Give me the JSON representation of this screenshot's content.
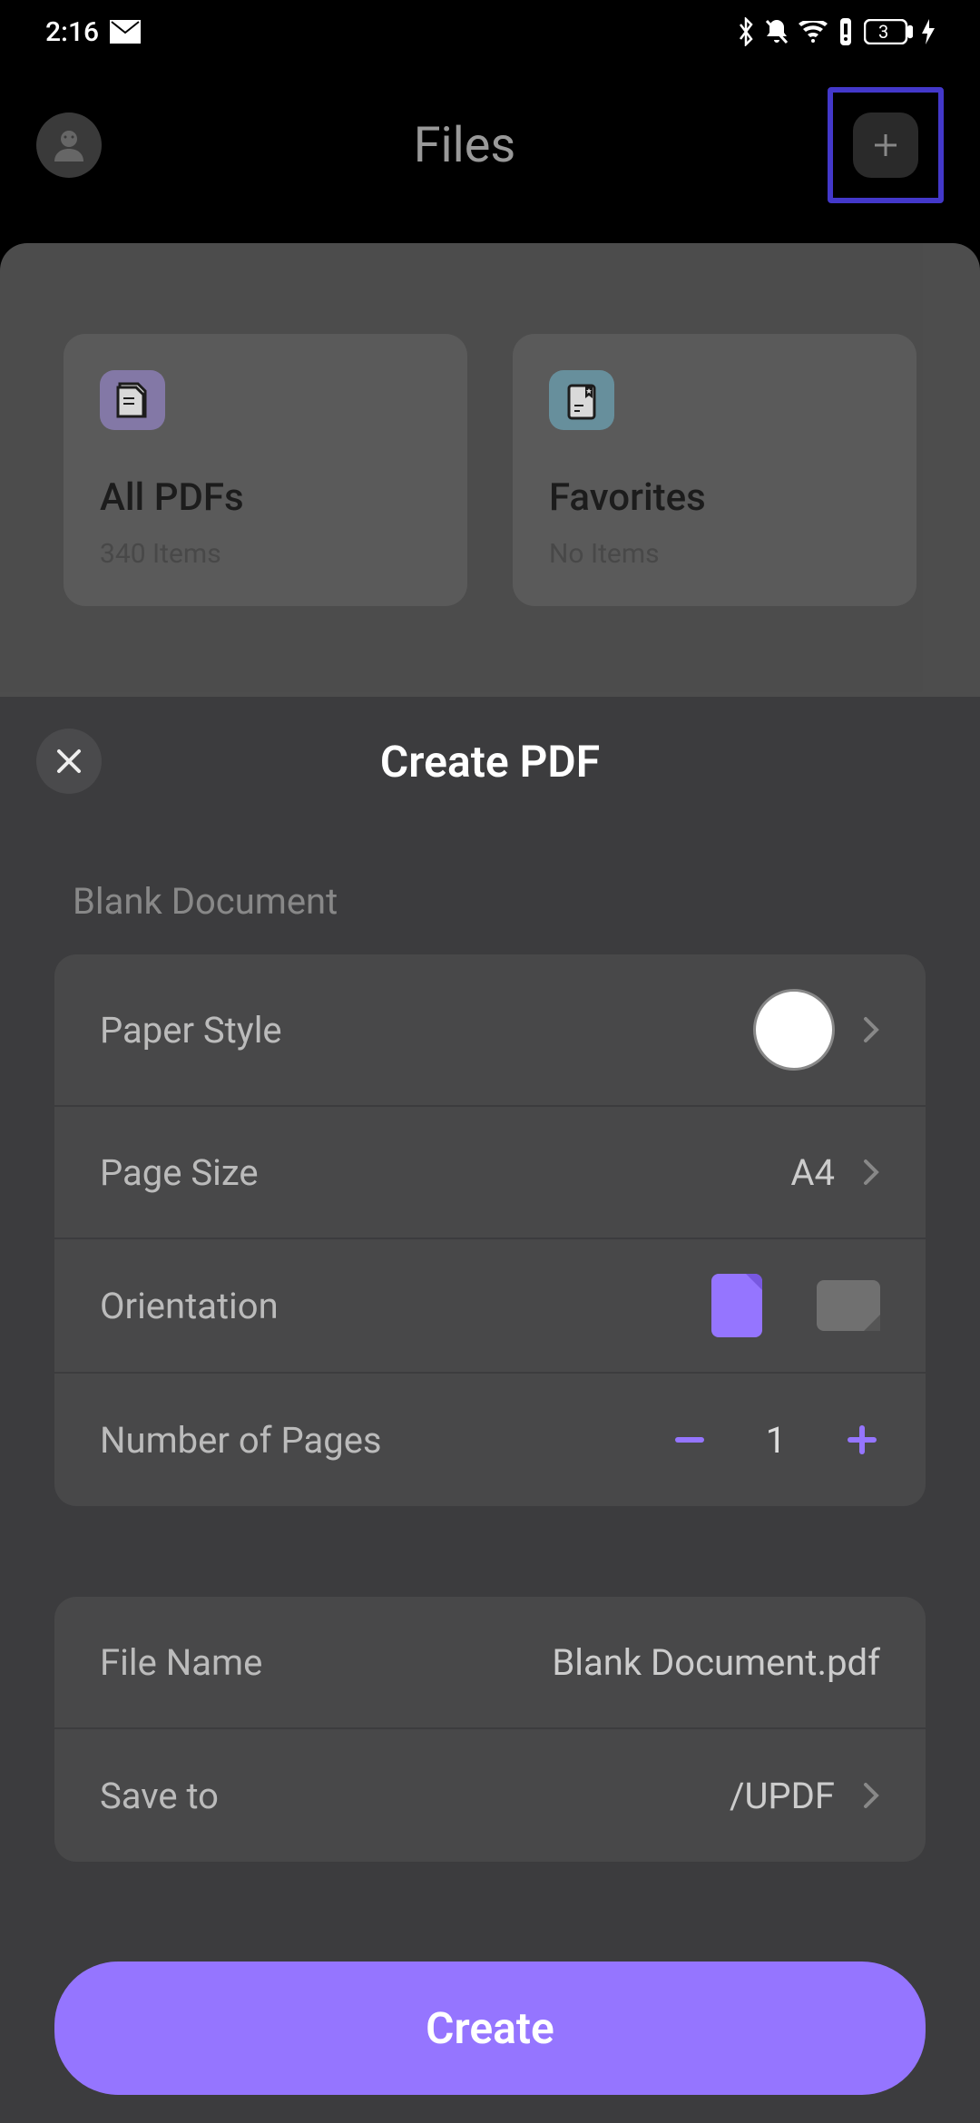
{
  "status": {
    "time": "2:16",
    "battery": "3"
  },
  "header": {
    "title": "Files"
  },
  "bg": {
    "card1": {
      "title": "All PDFs",
      "sub": "340 Items"
    },
    "card2": {
      "title": "Favorites",
      "sub": "No Items"
    }
  },
  "modal": {
    "title": "Create PDF",
    "section_label": "Blank Document",
    "paper_style_label": "Paper Style",
    "page_size_label": "Page Size",
    "page_size_value": "A4",
    "orientation_label": "Orientation",
    "pages_label": "Number of Pages",
    "pages_value": "1",
    "file_name_label": "File Name",
    "file_name_value": "Blank Document.pdf",
    "save_to_label": "Save to",
    "save_to_value": "/UPDF",
    "create_label": "Create"
  }
}
